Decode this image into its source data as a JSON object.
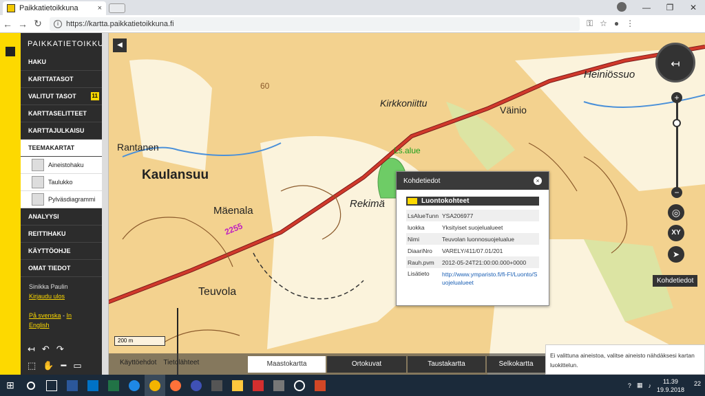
{
  "browser": {
    "tab_title": "Paikkatietoikkuna",
    "tab_close": "×",
    "url": "https://kartta.paikkatietoikkuna.fi",
    "win_min": "—",
    "win_max": "❐",
    "win_close": "✕"
  },
  "sidebar": {
    "brand": "PAIKKATIETOIKKUNA",
    "menu": [
      {
        "label": "HAKU"
      },
      {
        "label": "KARTTATASOT"
      },
      {
        "label": "VALITUT TASOT",
        "badge": "11"
      },
      {
        "label": "KARTTASELITTEET"
      },
      {
        "label": "KARTTAJULKAISU"
      }
    ],
    "theme_header": "TEEMAKARTAT",
    "theme_items": [
      {
        "label": "Aineistohaku"
      },
      {
        "label": "Taulukko"
      },
      {
        "label": "Pylväsdiagrammi"
      }
    ],
    "menu2": [
      {
        "label": "ANALYYSI"
      },
      {
        "label": "REITTIHAKU"
      },
      {
        "label": "KÄYTTÖOHJE"
      },
      {
        "label": "OMAT TIEDOT"
      }
    ],
    "user_name": "Sinikka Paulin",
    "logout": "Kirjaudu ulos",
    "lang_sv": "På svenska",
    "lang_sep": " - ",
    "lang_in": "In",
    "lang_en": "English"
  },
  "map": {
    "labels": {
      "heiniossuo": "Heiniössuo",
      "kirkkoniittu": "Kirkkoniittu",
      "vainio": "Väinio",
      "rantanen": "Rantanen",
      "kaulansuu": "Kaulansuu",
      "maenala": "Mäenala",
      "teuvola": "Teuvola",
      "rekima": "Rekimä",
      "lsalue": "Ls.alue",
      "road": "2255",
      "contour60": "60"
    },
    "scale": "200 m",
    "colors": {
      "terrain": "#f3d28f",
      "road": "#c0392b",
      "protected": "#2ecc40"
    }
  },
  "popup": {
    "title": "Kohdetiedot",
    "layer": "Luontokohteet",
    "rows": [
      {
        "key": "LsAlueTunn",
        "value": "YSA206977"
      },
      {
        "key": "luokka",
        "value": "Yksityiset suojelualueet"
      },
      {
        "key": "Nimi",
        "value": "Teuvolan luonnosuojelualue"
      },
      {
        "key": "DiaariNro",
        "value": "VARELY/411/07.01/201"
      },
      {
        "key": "Rauh.pvm",
        "value": "2012-05-24T21:00:00.000+0000"
      },
      {
        "key": "Lisätieto",
        "value": "http://www.ymparisto.fi/fi-FI/Luonto/Suojelualueet"
      }
    ]
  },
  "controls": {
    "xy": "XY",
    "tooltip": "Kohdetiedot",
    "zoom_in": "+",
    "zoom_out": "−"
  },
  "bottom": {
    "links": [
      "Käyttöehdot",
      "Tietolähteet"
    ],
    "tabs": [
      "Maastokartta",
      "Ortokuvat",
      "Taustakartta",
      "Selkokartta"
    ]
  },
  "notification": "Ei valittuna aineistoa, valitse aineisto nähdäksesi kartan luokittelun.",
  "taskbar": {
    "time": "11.39",
    "date": "19.9.2018",
    "notif_count": "22"
  }
}
